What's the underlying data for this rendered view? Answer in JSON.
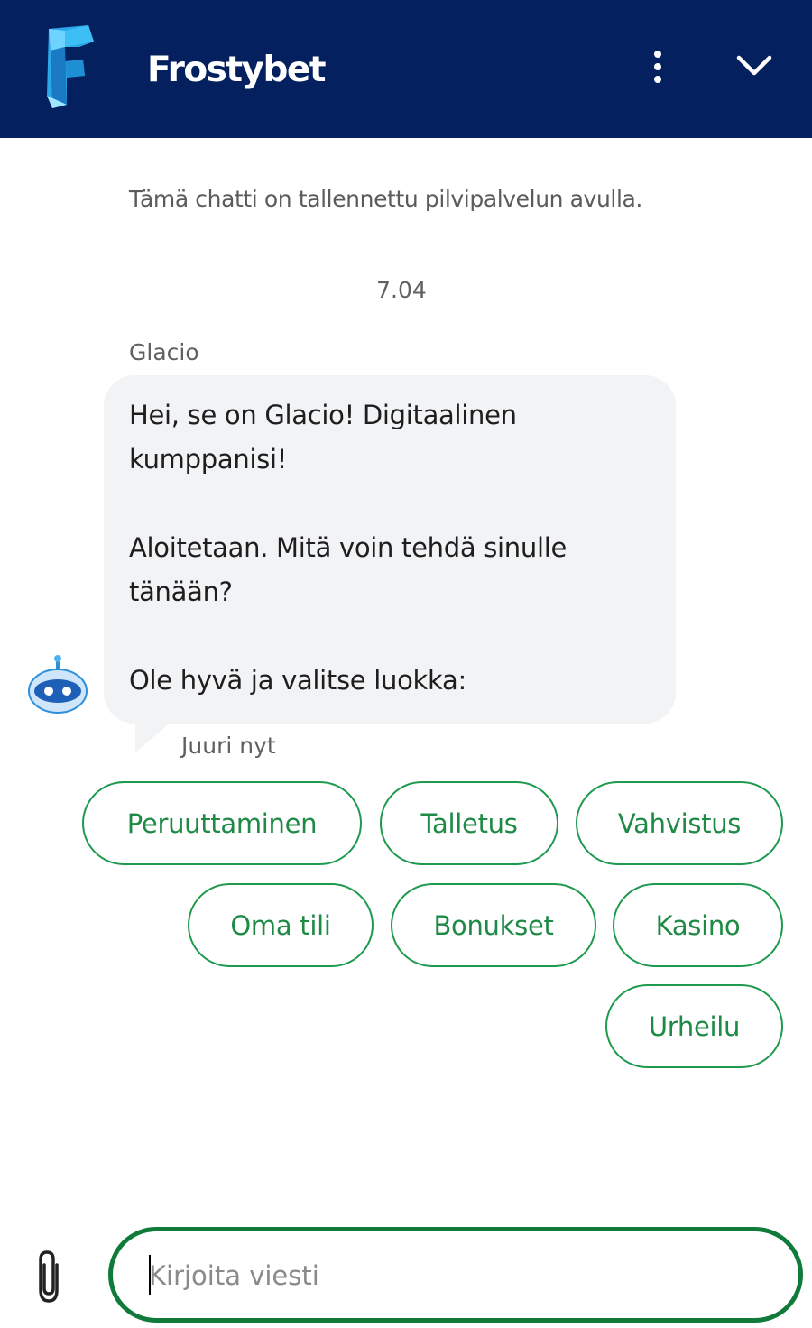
{
  "header": {
    "brand": "Frostybet",
    "background": "#04205f",
    "menu_icon": "more-vertical-icon",
    "collapse_icon": "chevron-down-icon"
  },
  "chat": {
    "notice": "Tämä chatti on tallennettu pilvipalvelun avulla.",
    "timestamp": "7.04",
    "sender": "Glacio",
    "message": {
      "line1": "Hei, se on Glacio! Digitaalinen kumppanisi!",
      "line2": "Aloitetaan. Mitä voin tehdä sinulle tänään?",
      "line3": "Ole hyvä ja valitse luokka:"
    },
    "message_time": "Juuri nyt"
  },
  "quick_replies": [
    {
      "label": "Peruuttaminen"
    },
    {
      "label": "Talletus"
    },
    {
      "label": "Vahvistus"
    },
    {
      "label": "Oma tili"
    },
    {
      "label": "Bonukset"
    },
    {
      "label": "Kasino"
    },
    {
      "label": "Urheilu"
    }
  ],
  "composer": {
    "placeholder": "Kirjoita viesti",
    "value": "",
    "attach_icon": "paperclip-icon",
    "accent": "#107a3a"
  }
}
